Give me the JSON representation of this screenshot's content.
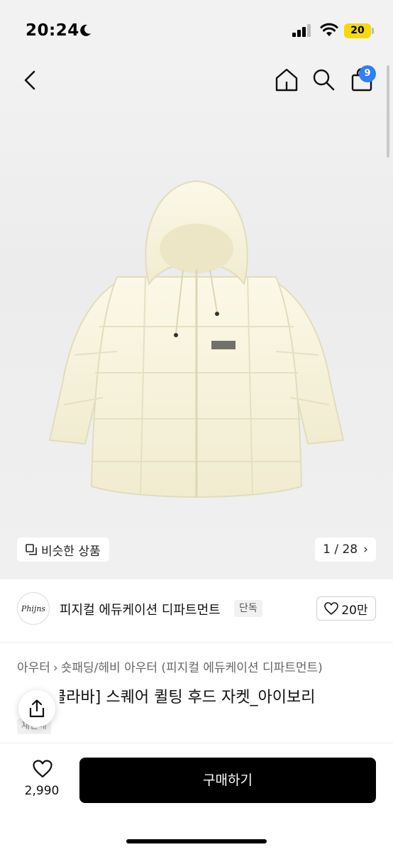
{
  "status_bar": {
    "time": "20:24",
    "battery": "20"
  },
  "header": {
    "cart_count": "9",
    "icons": [
      "chevron-left-icon",
      "home-icon",
      "search-icon",
      "shopping-bag-icon"
    ]
  },
  "hero": {
    "similar_label": "비슷한 상품",
    "pager": "1 / 28"
  },
  "brand": {
    "logo_text": "Phijns",
    "name": "피지컬 에듀케이션 디파트먼트",
    "tag": "단독",
    "likes": "20만"
  },
  "breadcrumb": {
    "level1": "아우터",
    "level2": "숏패딩/헤비 아우터",
    "brand_suffix": "(피지컬 에듀케이션 디파트먼트)"
  },
  "product": {
    "title": "[리브클라바] 스퀘어 퀼팅 후드 자켓_아이보리",
    "sub_tag": "재판매"
  },
  "bottom": {
    "like_count": "2,990",
    "buy_label": "구매하기"
  },
  "colors": {
    "badge": "#2f7ff5",
    "buy_button": "#000000",
    "jacket": "#f7f3dc"
  }
}
